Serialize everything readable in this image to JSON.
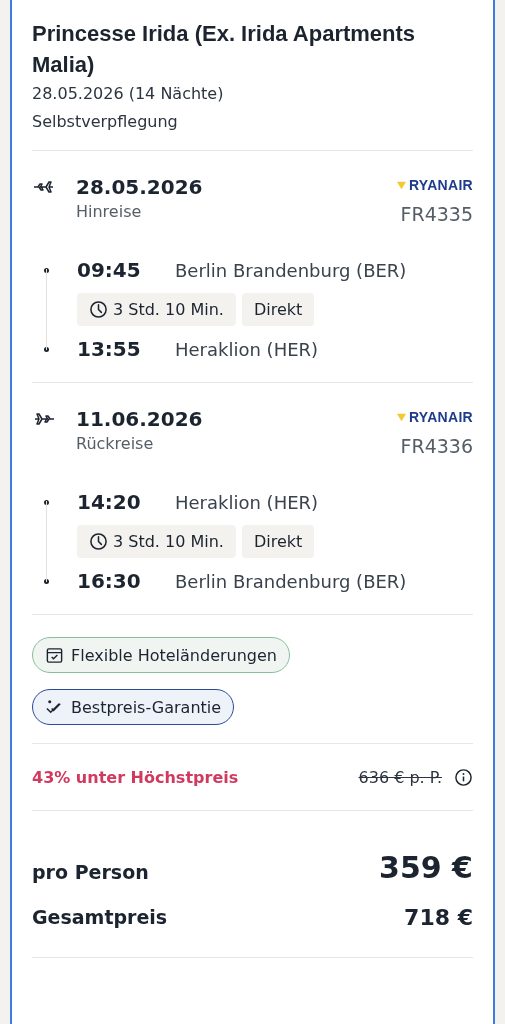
{
  "hotel": {
    "name": "Princesse Irida (Ex. Irida Apartments Malia)",
    "dates": "28.05.2026 (14 Nächte)",
    "board": "Selbstverpflegung"
  },
  "flights": [
    {
      "kind": "outbound",
      "date": "28.05.2026",
      "label": "Hinreise",
      "airline": "RYANAIR",
      "flight_number": "FR4335",
      "departure": {
        "time": "09:45",
        "airport": "Berlin Brandenburg (BER)"
      },
      "duration": "3 Std. 10 Min.",
      "stops": "Direkt",
      "arrival": {
        "time": "13:55",
        "airport": "Heraklion (HER)"
      }
    },
    {
      "kind": "return",
      "date": "11.06.2026",
      "label": "Rückreise",
      "airline": "RYANAIR",
      "flight_number": "FR4336",
      "departure": {
        "time": "14:20",
        "airport": "Heraklion (HER)"
      },
      "duration": "3 Std. 10 Min.",
      "stops": "Direkt",
      "arrival": {
        "time": "16:30",
        "airport": "Berlin Brandenburg (BER)"
      }
    }
  ],
  "badges": [
    {
      "kind": "flex",
      "label": "Flexible Hoteländerungen"
    },
    {
      "kind": "bestprice",
      "label": "Bestpreis-Garantie"
    }
  ],
  "discount": {
    "label": "43% unter Höchstpreis",
    "old_price": "636 € p. P."
  },
  "prices": [
    {
      "kind": "main",
      "label": "pro Person",
      "value": "359 €"
    },
    {
      "kind": "total",
      "label": "Gesamtpreis",
      "value": "718 €"
    }
  ]
}
